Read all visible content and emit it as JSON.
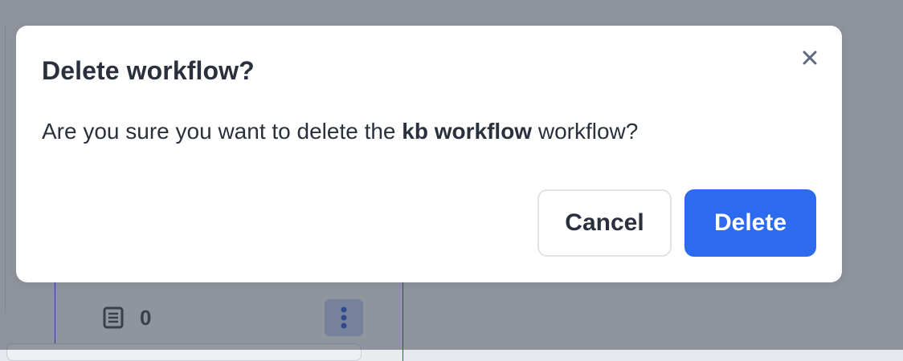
{
  "background": {
    "item_count": "0",
    "icons": {
      "count_icon": "document-list-icon",
      "menu_icon": "kebab-menu-icon"
    }
  },
  "modal": {
    "title": "Delete workflow?",
    "message_prefix": "Are you sure you want to delete the ",
    "workflow_name": "kb workflow",
    "message_suffix": " workflow?",
    "close_icon": "close-icon",
    "cancel_label": "Cancel",
    "delete_label": "Delete"
  },
  "colors": {
    "primary": "#2c6bef",
    "text": "#2a303c",
    "close_icon": "#5f6b7e"
  }
}
